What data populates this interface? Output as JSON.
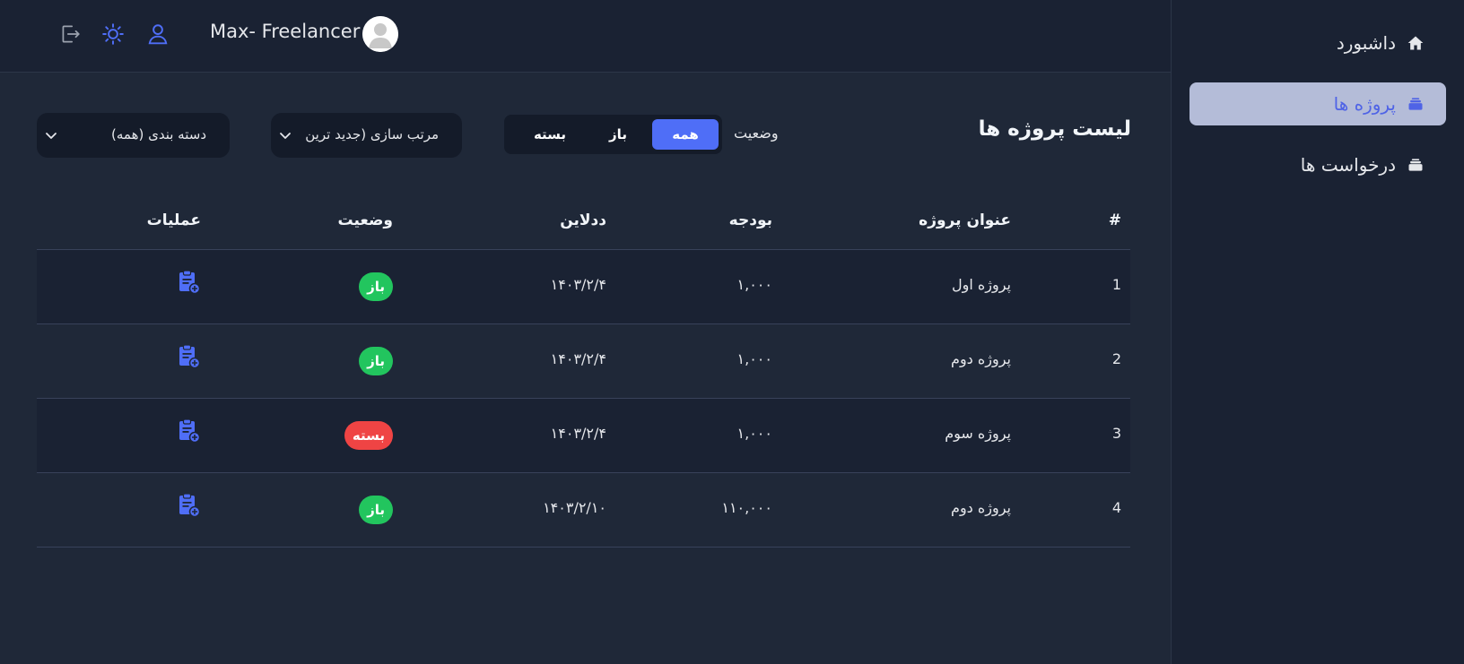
{
  "sidebar": {
    "items": [
      {
        "label": "داشبورد",
        "icon": "home-icon",
        "active": false
      },
      {
        "label": "پروژه ها",
        "icon": "stack-icon",
        "active": true
      },
      {
        "label": "درخواست ها",
        "icon": "stack-icon",
        "active": false
      }
    ]
  },
  "header": {
    "username": "Max- Freelancer",
    "icons": [
      "logout-icon",
      "sun-icon",
      "user-icon"
    ]
  },
  "main": {
    "title": "لیست پروژه ها",
    "status_label": "وضعیت",
    "status_filter": {
      "options": [
        "همه",
        "باز",
        "بسته"
      ],
      "selected": "همه"
    },
    "sort_dropdown": {
      "value": "مرتب سازی (جدید ترین"
    },
    "category_dropdown": {
      "value": "دسته بندی (همه)"
    }
  },
  "table": {
    "headers": [
      "#",
      "عنوان پروژه",
      "بودجه",
      "ددلاین",
      "وضعیت",
      "عملیات"
    ],
    "rows": [
      {
        "num": "1",
        "title": "پروژه اول",
        "budget": "۱,۰۰۰",
        "deadline": "۱۴۰۳/۲/۴",
        "status": "باز",
        "status_type": "open"
      },
      {
        "num": "2",
        "title": "پروژه دوم",
        "budget": "۱,۰۰۰",
        "deadline": "۱۴۰۳/۲/۴",
        "status": "باز",
        "status_type": "open"
      },
      {
        "num": "3",
        "title": "پروژه سوم",
        "budget": "۱,۰۰۰",
        "deadline": "۱۴۰۳/۲/۴",
        "status": "بسته",
        "status_type": "closed"
      },
      {
        "num": "4",
        "title": "پروژه دوم",
        "budget": "۱۱۰,۰۰۰",
        "deadline": "۱۴۰۳/۲/۱۰",
        "status": "باز",
        "status_type": "open"
      }
    ]
  },
  "colors": {
    "accent": "#4f6ef7",
    "open": "#22c55e",
    "closed": "#ef4444",
    "background": "#1f2838",
    "panel": "#1a2233"
  }
}
